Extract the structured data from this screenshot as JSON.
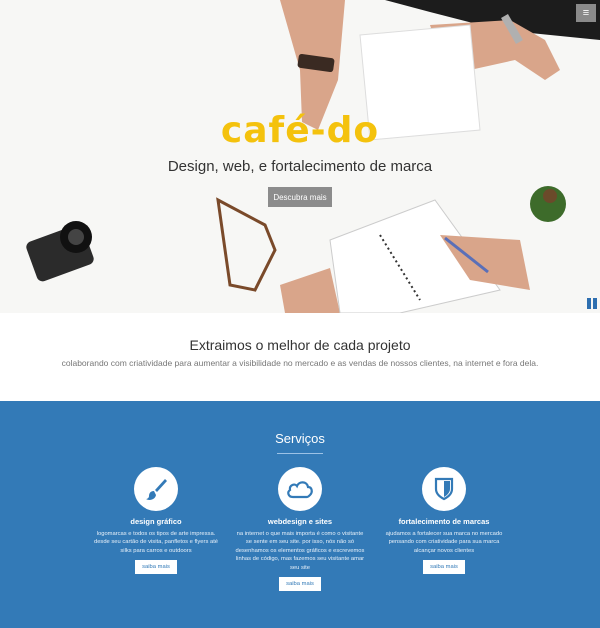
{
  "header": {
    "menu_icon": "hamburger-icon",
    "menu_glyph": "≡"
  },
  "hero": {
    "logo": "café-do",
    "tagline": "Design, web, e fortalecimento de marca",
    "cta_label": "Descubra mais",
    "pause_icon": "pause-icon"
  },
  "intro": {
    "title": "Extraimos o melhor de cada projeto",
    "subtitle": "colaborando com criatividade para aumentar a visibilidade no mercado e as vendas de nossos clientes, na internet e fora dela."
  },
  "services": {
    "title": "Serviços",
    "items": [
      {
        "icon": "paintbrush-icon",
        "title": "design gráfico",
        "lines": [
          "logomarcas e todos os tipos de arte impressa.",
          "desde seu cartão de visita, panfletos e flyers até",
          "silks para carros e outdoors"
        ],
        "button": "saiba mais"
      },
      {
        "icon": "cloud-icon",
        "title": "webdesign e sites",
        "lines": [
          "na internet o que mais importa é como o visitante",
          "se sente em seu site. por isso, nós não só",
          "desenhamos os elementos gráficos e escrevemos",
          "linhas de código, mas fazemos seu visitante amar",
          "seu site"
        ],
        "button": "saiba mais"
      },
      {
        "icon": "shield-icon",
        "title": "fortalecimento de marcas",
        "lines": [
          "ajudamos a fortalecer sua marca no mercado",
          "pensando com criatividade para sua marca",
          "alcançar novos clientes"
        ],
        "button": "saiba mais"
      }
    ]
  },
  "colors": {
    "brand_yellow": "#f4c20d",
    "services_blue": "#337ab7"
  }
}
